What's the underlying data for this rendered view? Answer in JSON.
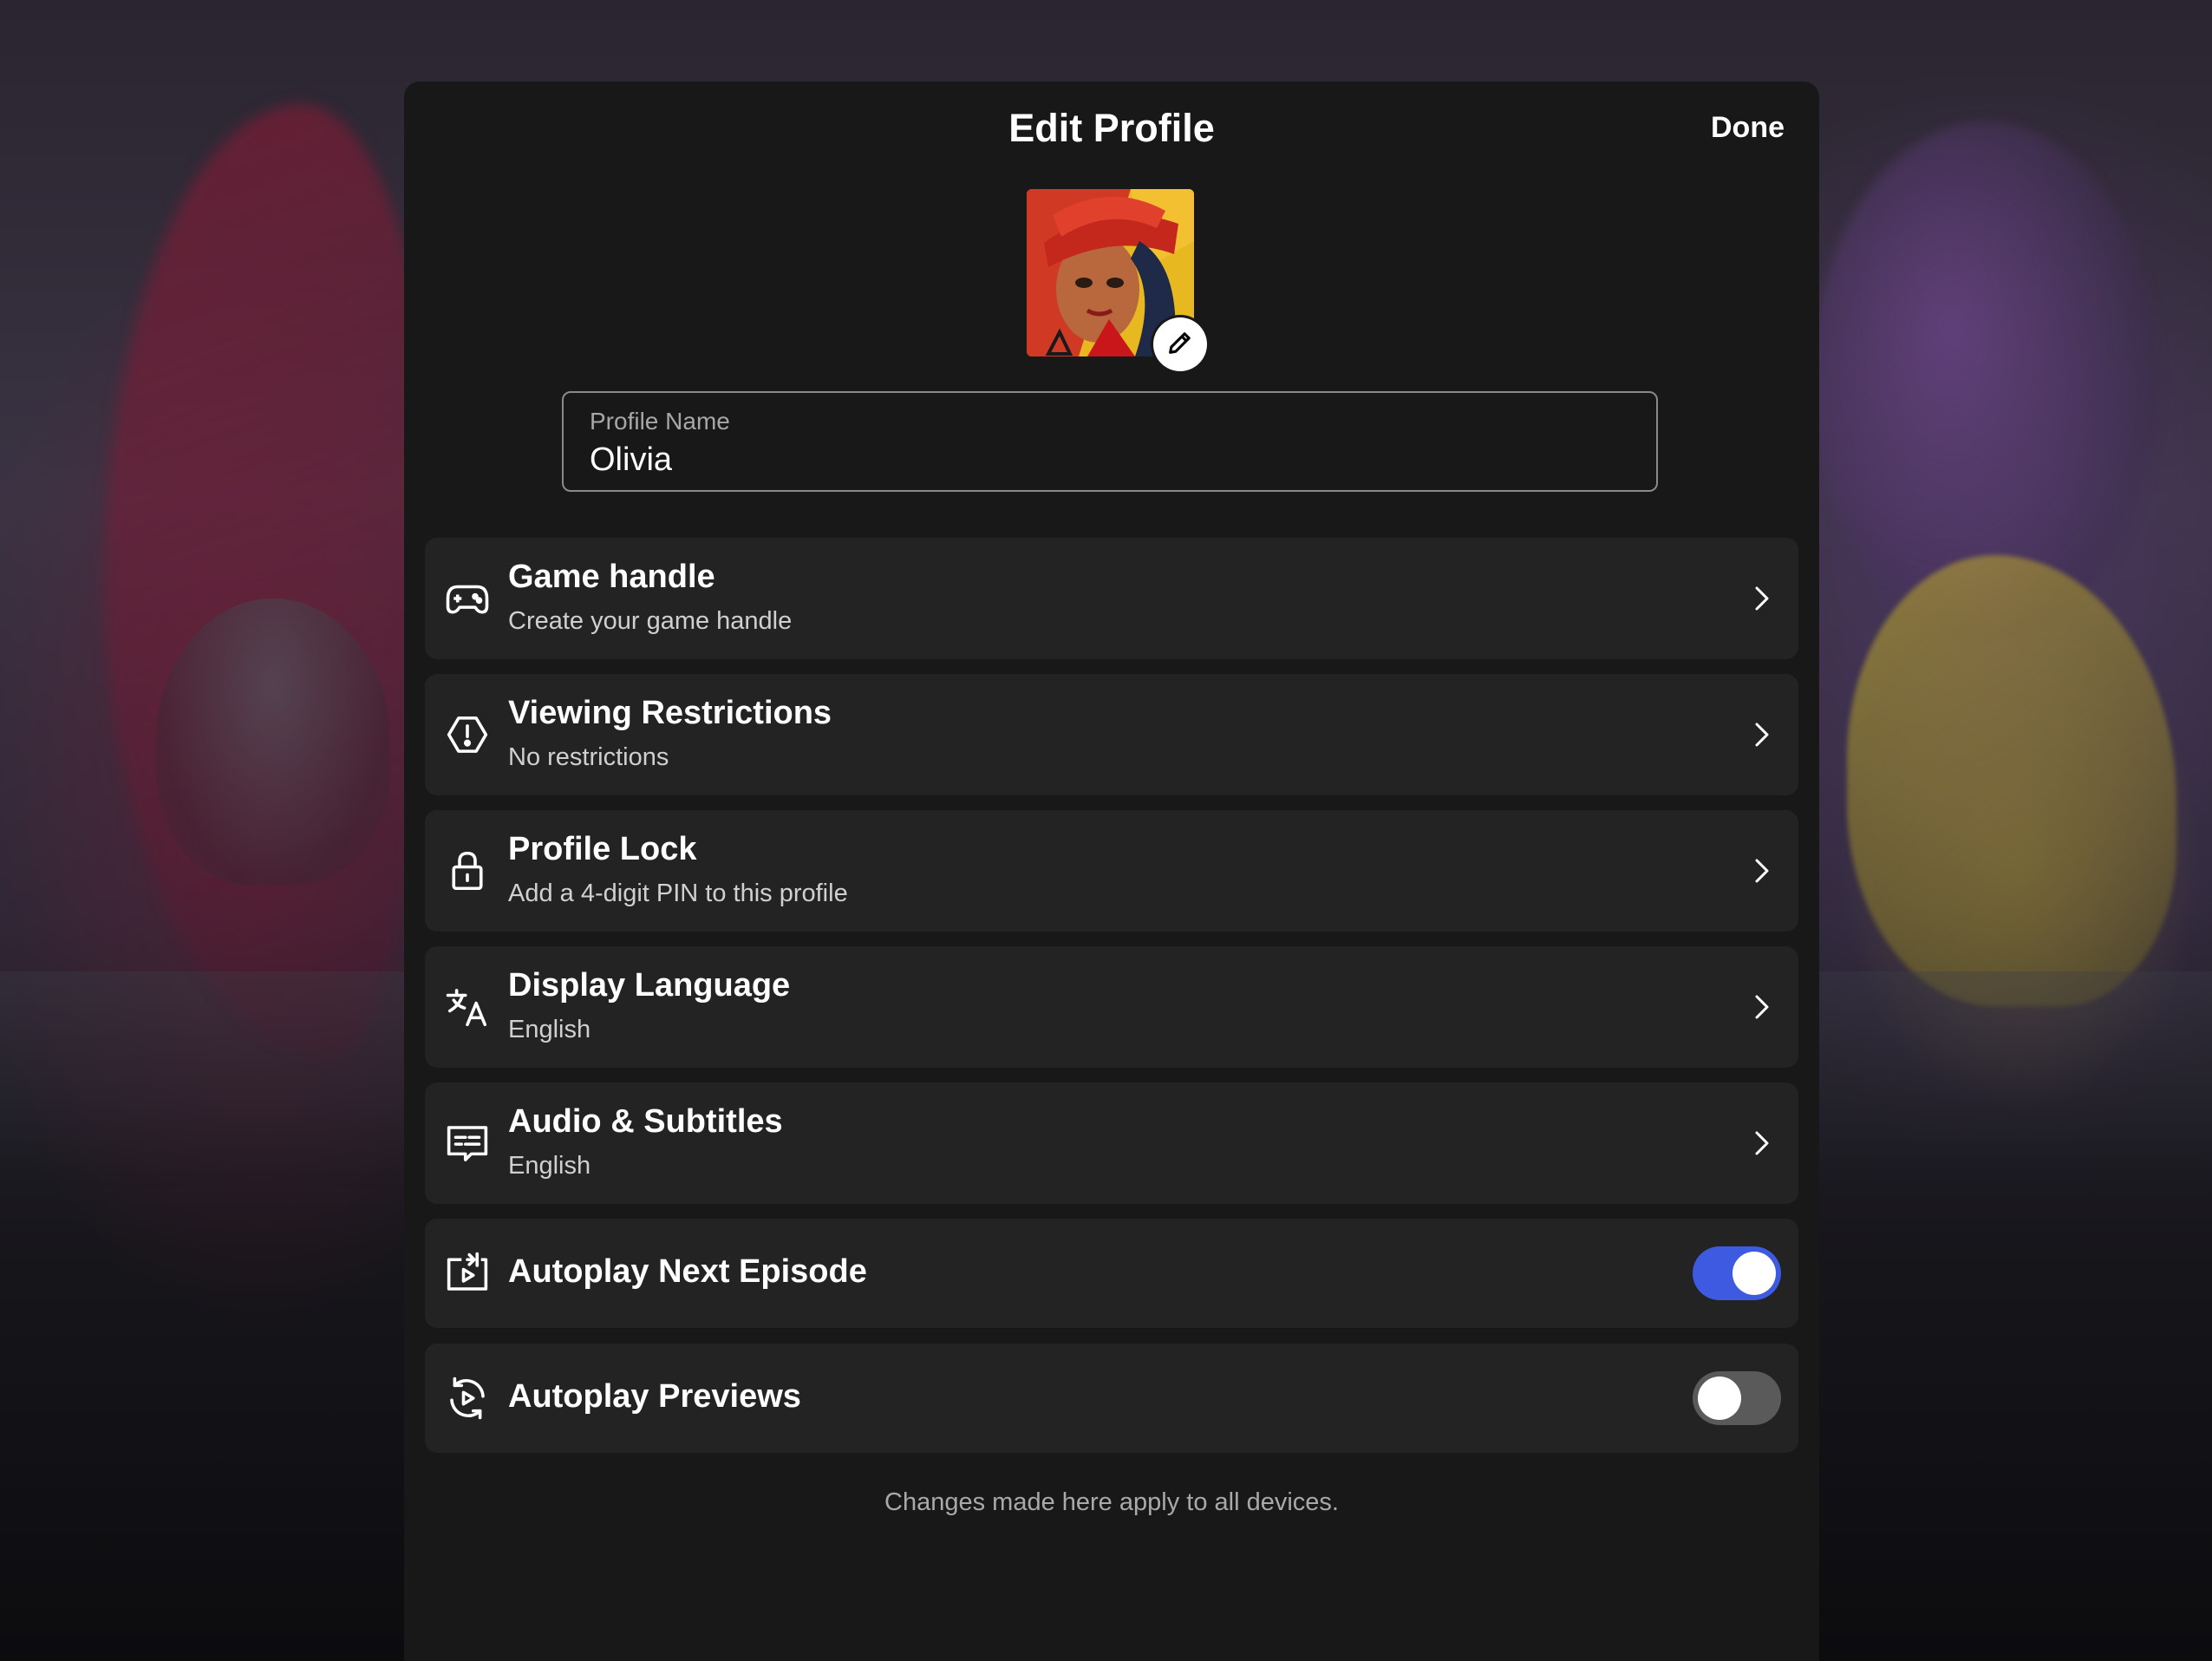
{
  "dialog": {
    "title": "Edit Profile",
    "done_label": "Done"
  },
  "profile_name": {
    "label": "Profile Name",
    "value": "Olivia"
  },
  "settings": [
    {
      "icon": "gamepad-icon",
      "title": "Game handle",
      "subtitle": "Create your game handle"
    },
    {
      "icon": "warning-hexagon-icon",
      "title": "Viewing Restrictions",
      "subtitle": "No restrictions"
    },
    {
      "icon": "lock-icon",
      "title": "Profile Lock",
      "subtitle": "Add a 4-digit PIN to this profile"
    },
    {
      "icon": "translate-icon",
      "title": "Display Language",
      "subtitle": "English"
    },
    {
      "icon": "subtitles-icon",
      "title": "Audio & Subtitles",
      "subtitle": "English"
    }
  ],
  "toggles": [
    {
      "icon": "autoplay-next-icon",
      "title": "Autoplay Next Episode",
      "on": true
    },
    {
      "icon": "autoplay-previews-icon",
      "title": "Autoplay Previews",
      "on": false
    }
  ],
  "footer_note": "Changes made here apply to all devices.",
  "colors": {
    "toggle_on": "#3d5ae0",
    "toggle_off": "#5a5a5a",
    "panel": "#181818",
    "row": "#232323"
  }
}
